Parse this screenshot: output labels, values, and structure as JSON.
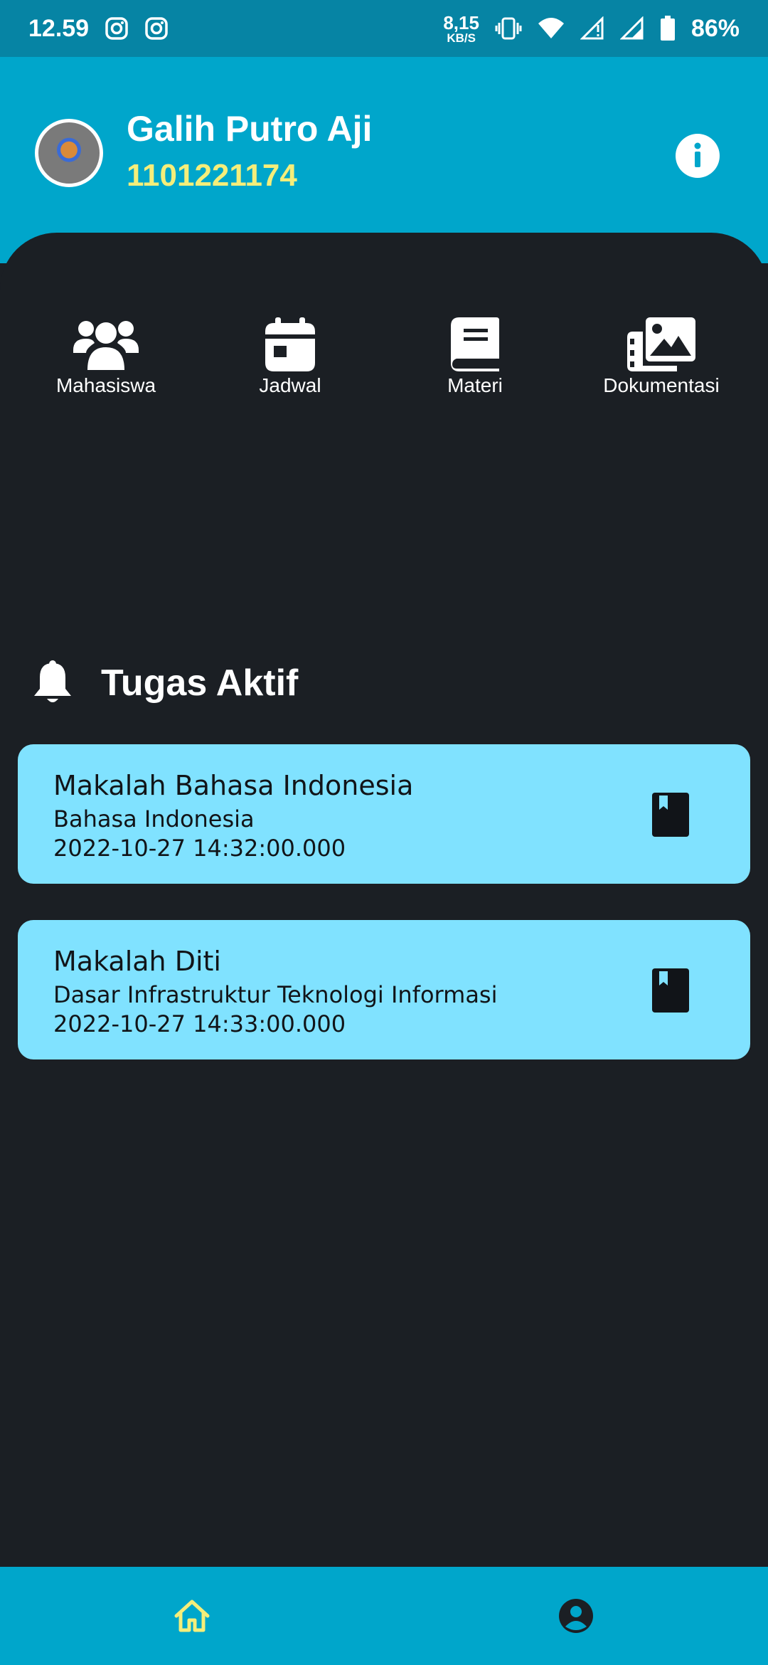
{
  "status_bar": {
    "time": "12.59",
    "net_speed_value": "8,15",
    "net_speed_unit": "KB/S",
    "battery": "86%",
    "icons": [
      "instagram-icon",
      "instagram-icon",
      "vibrate-icon",
      "wifi-icon",
      "signal-icon",
      "signal-icon",
      "battery-icon"
    ]
  },
  "profile": {
    "name": "Galih Putro Aji",
    "nim": "1101221174",
    "info_icon": "info-icon"
  },
  "menu": [
    {
      "label": "Mahasiswa",
      "icon": "users-icon"
    },
    {
      "label": "Jadwal",
      "icon": "calendar-icon"
    },
    {
      "label": "Materi",
      "icon": "book-icon"
    },
    {
      "label": "Dokumentasi",
      "icon": "images-icon"
    }
  ],
  "active_tasks": {
    "title": "Tugas Aktif",
    "icon": "bell-icon",
    "items": [
      {
        "title": "Makalah Bahasa Indonesia",
        "course": "Bahasa Indonesia",
        "deadline": "2022-10-27 14:32:00.000",
        "icon": "bookmark-book-icon"
      },
      {
        "title": "Makalah Diti",
        "course": "Dasar Infrastruktur Teknologi Informasi",
        "deadline": "2022-10-27 14:33:00.000",
        "icon": "bookmark-book-icon"
      }
    ]
  },
  "bottom_nav": [
    {
      "name": "home",
      "icon": "home-icon",
      "active": true
    },
    {
      "name": "profile",
      "icon": "profile-icon",
      "active": false
    }
  ],
  "colors": {
    "header": "#00a6cb",
    "status_bar": "#0684a4",
    "background": "#1b1f24",
    "card": "#80e2ff",
    "nim": "#f5ee7a",
    "nav_active": "#f5ee7a",
    "nav_inactive": "#1b1f24"
  }
}
